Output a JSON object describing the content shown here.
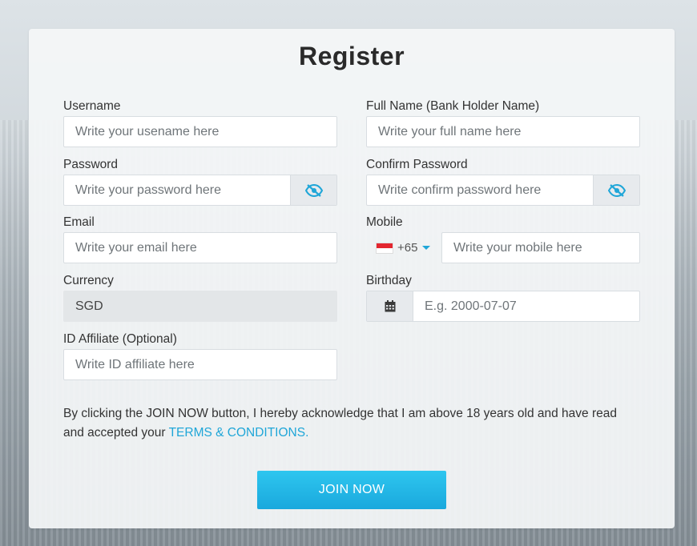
{
  "title": "Register",
  "fields": {
    "username": {
      "label": "Username",
      "placeholder": "Write your usename here"
    },
    "fullname": {
      "label": "Full Name (Bank Holder Name)",
      "placeholder": "Write your full name here"
    },
    "password": {
      "label": "Password",
      "placeholder": "Write your password here"
    },
    "confirm_password": {
      "label": "Confirm Password",
      "placeholder": "Write confirm password here"
    },
    "email": {
      "label": "Email",
      "placeholder": "Write your email here"
    },
    "mobile": {
      "label": "Mobile",
      "country_code": "+65",
      "placeholder": "Write your mobile here"
    },
    "currency": {
      "label": "Currency",
      "value": "SGD"
    },
    "birthday": {
      "label": "Birthday",
      "placeholder": "E.g. 2000-07-07"
    },
    "affiliate": {
      "label": "ID Affiliate (Optional)",
      "placeholder": "Write ID affiliate here"
    }
  },
  "disclaimer": {
    "text": "By clicking the JOIN NOW button, I hereby acknowledge that I am above 18 years old and have read and accepted your ",
    "link": "TERMS & CONDITIONS."
  },
  "join_button": "JOIN NOW",
  "colors": {
    "accent": "#1fa6d8",
    "button": "#22b5e6"
  },
  "icons": {
    "password_toggle": "eye-slash-icon",
    "birthday": "calendar-icon",
    "flag": "singapore-flag-icon"
  }
}
